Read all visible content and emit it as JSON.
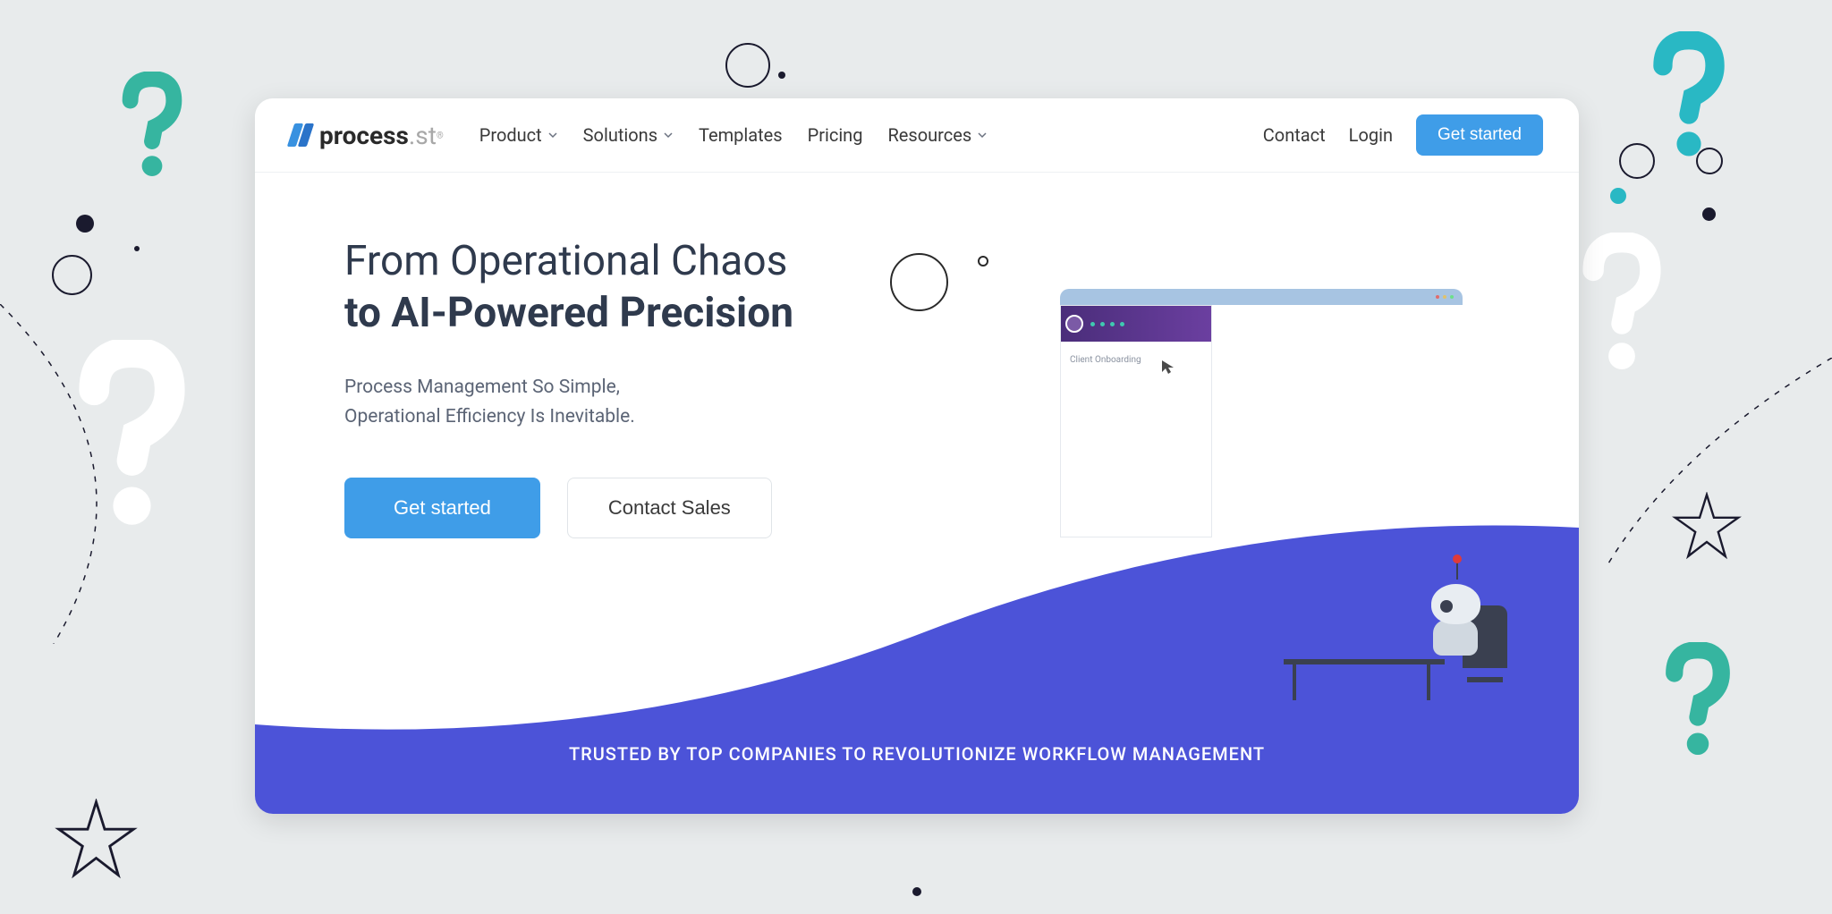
{
  "logo": {
    "name": "process",
    "ext": ".st"
  },
  "nav": {
    "items": [
      {
        "label": "Product",
        "dropdown": true
      },
      {
        "label": "Solutions",
        "dropdown": true
      },
      {
        "label": "Templates",
        "dropdown": false
      },
      {
        "label": "Pricing",
        "dropdown": false
      },
      {
        "label": "Resources",
        "dropdown": true
      }
    ],
    "right": {
      "contact": "Contact",
      "login": "Login",
      "cta": "Get started"
    }
  },
  "hero": {
    "title_line1": "From Operational Chaos",
    "title_line2": "to AI-Powered Precision",
    "sub_line1": "Process Management So Simple,",
    "sub_line2": "Operational Efficiency Is Inevitable.",
    "primary_cta": "Get started",
    "secondary_cta": "Contact Sales"
  },
  "mockup": {
    "sidebar_label": "Client Onboarding"
  },
  "trust": "TRUSTED BY TOP COMPANIES TO REVOLUTIONIZE WORKFLOW MANAGEMENT",
  "colors": {
    "primary_blue": "#3f9de8",
    "indigo": "#4c53d8",
    "teal": "#36b5a0",
    "dark": "#1a1a2e"
  }
}
